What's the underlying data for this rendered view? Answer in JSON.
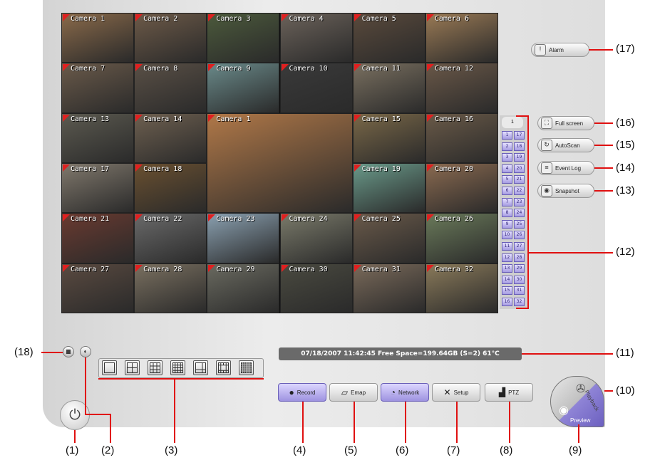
{
  "cameras": [
    {
      "label": "Camera 1",
      "bg": "#8a6a4a"
    },
    {
      "label": "Camera 2",
      "bg": "#6d5a48"
    },
    {
      "label": "Camera 3",
      "bg": "#4c5a3c"
    },
    {
      "label": "Camera 4",
      "bg": "#6b625a"
    },
    {
      "label": "Camera 5",
      "bg": "#5a4a3c"
    },
    {
      "label": "Camera 6",
      "bg": "#9a7a55"
    },
    {
      "label": "Camera 7",
      "bg": "#6a5a4a"
    },
    {
      "label": "Camera 8",
      "bg": "#5a5046"
    },
    {
      "label": "Camera 9",
      "bg": "#6a8a8a"
    },
    {
      "label": "Camera 10",
      "bg": "#3a3a3a"
    },
    {
      "label": "Camera 11",
      "bg": "#7a7060"
    },
    {
      "label": "Camera 12",
      "bg": "#6a5848"
    },
    {
      "label": "Camera 13",
      "bg": "#5c5a50"
    },
    {
      "label": "Camera 14",
      "bg": "#6e6050"
    },
    {
      "label": "Camera 1",
      "bg": "#b07848"
    },
    {
      "label": "Camera 15",
      "bg": "#7a6848"
    },
    {
      "label": "Camera 16",
      "bg": "#6a5a48"
    },
    {
      "label": "Camera 17",
      "bg": "#80786c"
    },
    {
      "label": "Camera 18",
      "bg": "#6a5030"
    },
    {
      "label": "Camera 19",
      "bg": "#6a9a8a"
    },
    {
      "label": "Camera 20",
      "bg": "#8a6a50"
    },
    {
      "label": "Camera 21",
      "bg": "#6a3a30"
    },
    {
      "label": "Camera 22",
      "bg": "#6a6a6a"
    },
    {
      "label": "Camera 23",
      "bg": "#8aa0b0"
    },
    {
      "label": "Camera 24",
      "bg": "#7a7a6a"
    },
    {
      "label": "Camera 25",
      "bg": "#6a5a4a"
    },
    {
      "label": "Camera 26",
      "bg": "#6a7a5a"
    },
    {
      "label": "Camera 27",
      "bg": "#5a4a40"
    },
    {
      "label": "Camera 28",
      "bg": "#7a7060"
    },
    {
      "label": "Camera 29",
      "bg": "#6a6a60"
    },
    {
      "label": "Camera 30",
      "bg": "#4a4a40"
    },
    {
      "label": "Camera 31",
      "bg": "#7a6a5a"
    },
    {
      "label": "Camera 32",
      "bg": "#8a7a5a"
    }
  ],
  "channel_icon_label": "1",
  "channels_left": [
    "1",
    "2",
    "3",
    "4",
    "5",
    "6",
    "7",
    "8",
    "9",
    "10",
    "11",
    "12",
    "13",
    "14",
    "15",
    "16"
  ],
  "channels_right": [
    "17",
    "18",
    "19",
    "20",
    "21",
    "22",
    "23",
    "24",
    "25",
    "26",
    "27",
    "28",
    "29",
    "30",
    "31",
    "32"
  ],
  "status_text": "07/18/2007 11:42:45  Free Space=199.64GB (S=2) 61°C",
  "right_buttons": {
    "alarm": "Alarm",
    "fullscreen": "Full screen",
    "autoscan": "AutoScan",
    "eventlog": "Event Log",
    "snapshot": "Snapshot"
  },
  "toolbar": {
    "record": "Record",
    "emap": "Emap",
    "network": "Network",
    "setup": "Setup",
    "ptz": "PTZ"
  },
  "dial": {
    "playback": "Playback",
    "preview": "Preview"
  },
  "annotations": {
    "a1": "(1)",
    "a2": "(2)",
    "a3": "(3)",
    "a4": "(4)",
    "a5": "(5)",
    "a6": "(6)",
    "a7": "(7)",
    "a8": "(8)",
    "a9": "(9)",
    "a10": "(10)",
    "a11": "(11)",
    "a12": "(12)",
    "a13": "(13)",
    "a14": "(14)",
    "a15": "(15)",
    "a16": "(16)",
    "a17": "(17)",
    "a18": "(18)"
  },
  "colors": {
    "accent": "#9e93e0",
    "annotation_line": "#e01010",
    "status_bg": "#6a6a6a"
  }
}
